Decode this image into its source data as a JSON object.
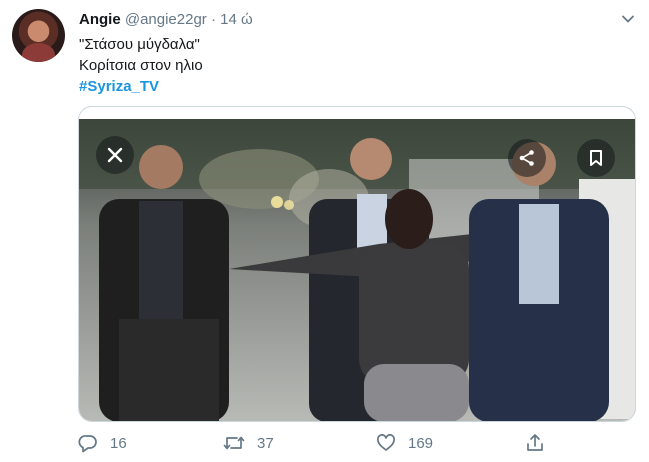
{
  "tweet": {
    "author_name": "Angie",
    "author_handle": "@angie22gr",
    "separator": "·",
    "time": "14 ώ",
    "lines": [
      "\"Στάσου μύγδαλα\"",
      "Κορίτσια στον ηλιο"
    ],
    "hashtag": "#Syriza_TV"
  },
  "media": {
    "close_icon": "close-icon",
    "share_icon": "share-icon",
    "bookmark_icon": "bookmark-icon"
  },
  "actions": {
    "reply_count": "16",
    "retweet_count": "37",
    "like_count": "169",
    "icons": [
      "reply-icon",
      "retweet-icon",
      "like-icon",
      "share-icon"
    ]
  },
  "colors": {
    "accent": "#1b95e0",
    "muted": "#657786",
    "text": "#14171a",
    "border": "#ccd6dd"
  }
}
